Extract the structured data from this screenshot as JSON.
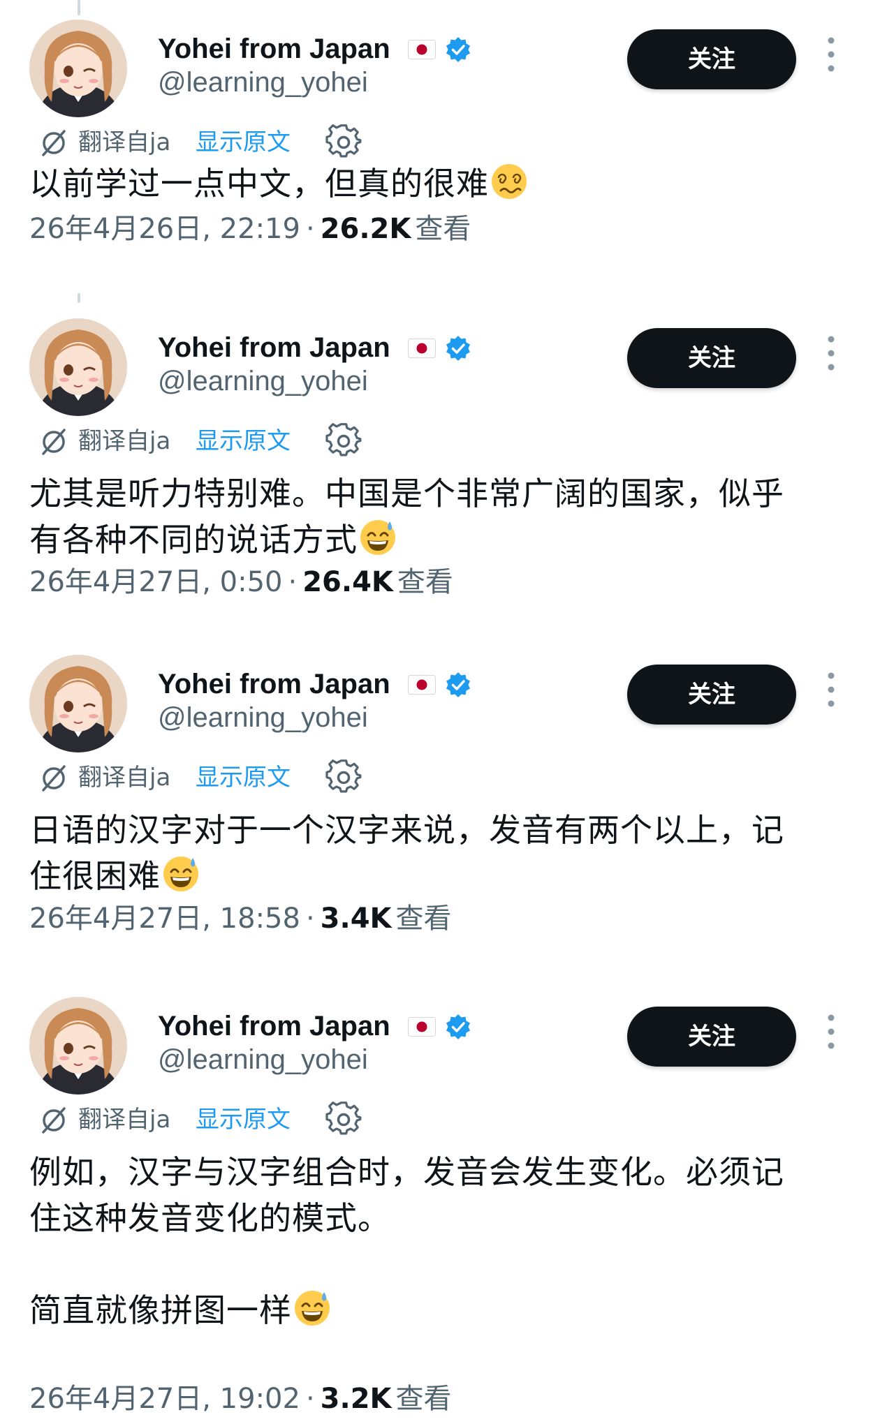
{
  "colors": {
    "text_primary": "#0f1419",
    "text_secondary": "#536471",
    "link_blue": "#1d9bf0",
    "follow_bg": "#0f1419",
    "verified_blue": "#1d9bf0"
  },
  "tweets": [
    {
      "author": {
        "name": "Yohei from Japan",
        "flag": "flag-japan-icon",
        "handle": "@learning_yohei",
        "verified": true
      },
      "follow_label": "关注",
      "translate_label": "翻译自ja",
      "show_original_label": "显示原文",
      "text_lines": [
        "以前学过一点中文，但真的很难"
      ],
      "emoji": "woozy-face-icon",
      "timestamp": "26年4月26日, 22:19",
      "views": "26.2K",
      "views_label": "查看"
    },
    {
      "author": {
        "name": "Yohei from Japan",
        "flag": "flag-japan-icon",
        "handle": "@learning_yohei",
        "verified": true
      },
      "follow_label": "关注",
      "translate_label": "翻译自ja",
      "show_original_label": "显示原文",
      "text_lines": [
        "尤其是听力特别难。中国是个非常广阔的国家，似乎",
        "有各种不同的说话方式"
      ],
      "emoji": "grinning-sweat-icon",
      "timestamp": "26年4月27日, 0:50",
      "views": "26.4K",
      "views_label": "查看"
    },
    {
      "author": {
        "name": "Yohei from Japan",
        "flag": "flag-japan-icon",
        "handle": "@learning_yohei",
        "verified": true
      },
      "follow_label": "关注",
      "translate_label": "翻译自ja",
      "show_original_label": "显示原文",
      "text_lines": [
        "日语的汉字对于一个汉字来说，发音有两个以上，记",
        "住很困难"
      ],
      "emoji": "grinning-sweat-icon",
      "timestamp": "26年4月27日, 18:58",
      "views": "3.4K",
      "views_label": "查看"
    },
    {
      "author": {
        "name": "Yohei from Japan",
        "flag": "flag-japan-icon",
        "handle": "@learning_yohei",
        "verified": true
      },
      "follow_label": "关注",
      "translate_label": "翻译自ja",
      "show_original_label": "显示原文",
      "text_lines": [
        "例如，汉字与汉字组合时，发音会发生变化。必须记",
        "住这种发音变化的模式。"
      ],
      "text_lines_2": [
        "简直就像拼图一样"
      ],
      "emoji": "grinning-sweat-icon",
      "timestamp": "26年4月27日, 19:02",
      "views": "3.2K",
      "views_label": "查看"
    }
  ]
}
